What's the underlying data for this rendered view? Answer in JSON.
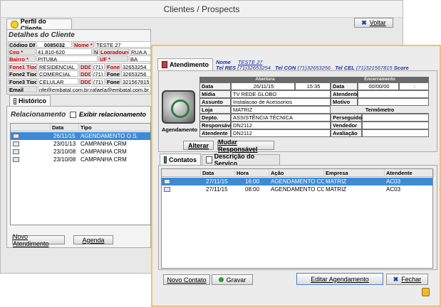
{
  "window": {
    "title": "Clientes / Prospects"
  },
  "tabs": {
    "perfil": "Perfil do Cliente",
    "historico": "Histórico"
  },
  "buttons": {
    "voltar": "Voltar",
    "novo_atendimento": "Novo Atendimento",
    "agenda": "Agenda",
    "alterar": "Alterar",
    "mudar_responsavel": "Mudar Responsável",
    "novo_contato": "Novo Contato",
    "gravar": "Gravar",
    "editar_agendamento": "Editar Agendamento",
    "fechar": "Fechar"
  },
  "details": {
    "title": "Detalhes do Cliente",
    "codigo_label": "Código DMS",
    "codigo": "0085032",
    "nome_label": "Nome *",
    "nome": "TESTE 27",
    "cep_label": "Cep *",
    "cep": "41.810-620",
    "n_label": "N",
    "logradouro_label": "Logradouro*",
    "logradouro": "RUA A",
    "bairro_label": "Bairro *",
    "bairro": "PITUBA",
    "uf_label": "UF *",
    "uf": "BA",
    "fone1tipo_label": "Fone1 Tipo*",
    "fone1tipo": "RESIDENCIAL",
    "ddd_label": "DDD",
    "ddd1": "(71)",
    "fone1_label": "Fone1",
    "fone1": "32653254",
    "fone2tipo_label": "Fone2 Tipo",
    "fone2tipo": "COMERCIAL",
    "ddd2": "(71)",
    "fone2_label": "Fone2",
    "fone2": "32653256",
    "fone3tipo_label": "Fone3 Tipo",
    "fone3tipo": "CELULAR",
    "ddd3": "(71)",
    "fone3_label": "Fone3",
    "fone3": "321567815",
    "email_label": "Email",
    "email": "nfe@embatal.com.br;rafaela@embatal.com.br"
  },
  "relacionamento": {
    "title": "Relacionamento",
    "exibir_label": "Exibir relacionamento",
    "headers": [
      "Data",
      "Tipo"
    ],
    "rows": [
      {
        "data": "26/11/15",
        "tipo": "AGENDAMENTO O.S.",
        "selected": true
      },
      {
        "data": "23/01/13",
        "tipo": "CAMPANHA CRM",
        "selected": false
      },
      {
        "data": "23/10/08",
        "tipo": "CAMPANHA CRM",
        "selected": false
      },
      {
        "data": "23/10/08",
        "tipo": "CAMPANHA CRM",
        "selected": false
      }
    ]
  },
  "dialog": {
    "tab_atendimento": "Atendimento",
    "nome_label": "Nome",
    "nome": "TESTE 27",
    "tel_res_label": "Tel RES",
    "tel_res": "(71)32653254",
    "tel_con_label": "Tel CON",
    "tel_con": "(71)32653256",
    "tel_cel_label": "Tel CEL",
    "tel_cel": "(71)321567815",
    "score_label": "Score",
    "agendamento_label": "Agendamento",
    "abertura_header": "Abertura",
    "encerramento_header": "Encerramento",
    "termometro_header": "Termômetro",
    "data_label": "Data",
    "data": "26/11/15",
    "hora": "15:35",
    "enc_data_label": "Data",
    "enc_data": "00/00/00",
    "enc_hora": ":",
    "midia_label": "Mídia",
    "midia": "TV REDE GLOBO",
    "assunto_label": "Assunto",
    "assunto": "Instalacao de Acessorios",
    "loja_label": "Loja",
    "loja": "MATRIZ",
    "depto_label": "Depto.",
    "depto": "ASSISTÊNCIA TÉCNICA",
    "responsavel_label": "Responsável",
    "responsavel": "DN2112",
    "atendente_label": "Atendente",
    "atendente": "DN2112",
    "enc_atendente_label": "Atendente",
    "motivo_label": "Motivo",
    "perseguidor_label": "Perseguidor",
    "vendedor_label": "Vendedor",
    "avaliacao_label": "Avaliação",
    "tab_contatos": "Contatos",
    "tab_descricao": "Descrição do Serviço",
    "contatos_headers": [
      "Data Prevista",
      "Hora Prevista",
      "Ação",
      "Empresa",
      "Atendente"
    ],
    "contatos_rows": [
      {
        "data": "27/11/15",
        "hora": "16:00",
        "acao": "AGENDAMENTO CON",
        "empresa": "MATRIZ",
        "atendente": "AC03",
        "selected": true,
        "struck": false
      },
      {
        "data": "27/11/15",
        "hora": "08:00",
        "acao": "AGENDAMENTO CO",
        "empresa": "MATRIZ",
        "atendente": "AC03",
        "selected": false,
        "struck": true
      }
    ]
  },
  "colors": {
    "selection": "#3d8bd6",
    "dialog_border": "#efc55b",
    "label_red": "#c40000",
    "link_blue": "#1d2fa0"
  }
}
